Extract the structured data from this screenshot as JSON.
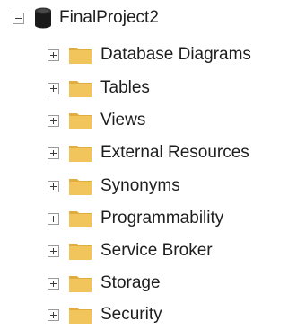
{
  "tree": {
    "root": {
      "label": "FinalProject2",
      "expanded": true,
      "icon": "database-icon"
    },
    "children": [
      {
        "label": "Database Diagrams",
        "icon": "folder-icon",
        "expanded": false
      },
      {
        "label": "Tables",
        "icon": "folder-icon",
        "expanded": false
      },
      {
        "label": "Views",
        "icon": "folder-icon",
        "expanded": false
      },
      {
        "label": "External Resources",
        "icon": "folder-icon",
        "expanded": false
      },
      {
        "label": "Synonyms",
        "icon": "folder-icon",
        "expanded": false
      },
      {
        "label": "Programmability",
        "icon": "folder-icon",
        "expanded": false
      },
      {
        "label": "Service Broker",
        "icon": "folder-icon",
        "expanded": false
      },
      {
        "label": "Storage",
        "icon": "folder-icon",
        "expanded": false
      },
      {
        "label": "Security",
        "icon": "folder-icon",
        "expanded": false
      }
    ]
  },
  "colors": {
    "folder": "#f2c55c",
    "folder_tab": "#e0ad3e",
    "database": "#1a1a1a",
    "expander_border": "#9a9a9a",
    "text": "#1e1e1e"
  }
}
